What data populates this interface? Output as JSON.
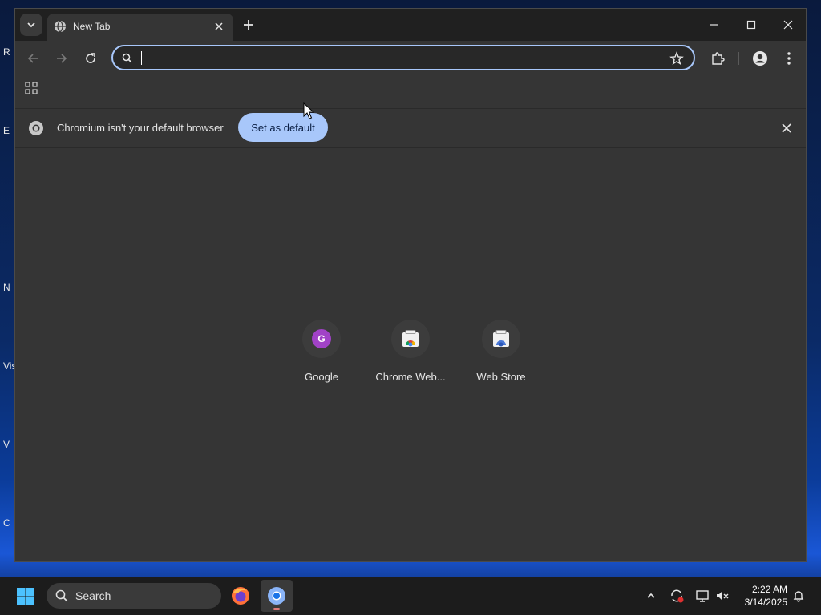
{
  "desktop": {
    "icon_labels": [
      "R",
      "E",
      "N",
      "Vis",
      "V",
      "C"
    ]
  },
  "browser": {
    "tab": {
      "title": "New Tab"
    },
    "omnibox": {
      "value": "",
      "placeholder": ""
    },
    "infobar": {
      "message": "Chromium isn't your default browser",
      "button_label": "Set as default"
    },
    "shortcuts": [
      {
        "label": "Google",
        "badge": "G"
      },
      {
        "label": "Chrome Web..."
      },
      {
        "label": "Web Store"
      }
    ],
    "colors": {
      "accent": "#a8c7fa",
      "google_badge": "#a142c7"
    }
  },
  "taskbar": {
    "search_label": "Search",
    "time": "2:22 AM",
    "date": "3/14/2025"
  }
}
